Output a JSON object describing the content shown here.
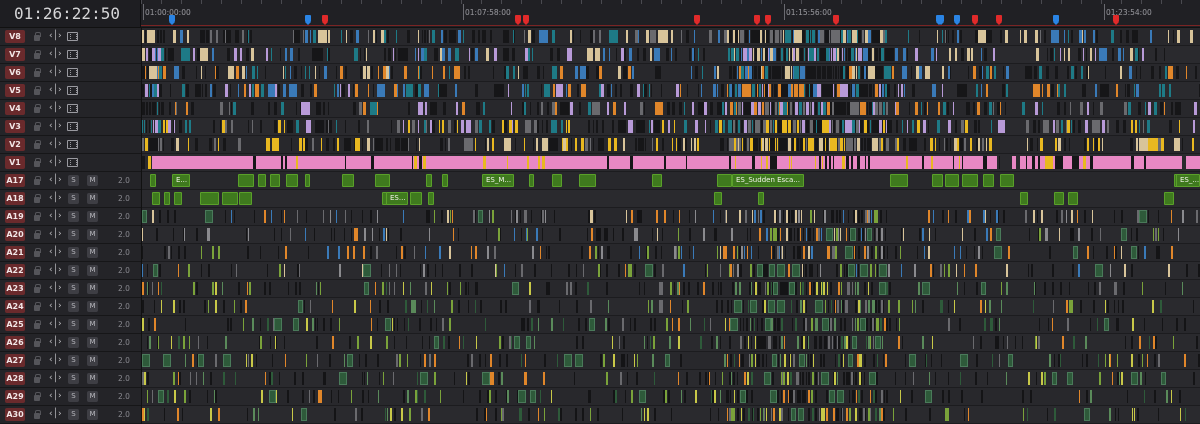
{
  "timecode": "01:26:22:50",
  "ruler": {
    "labels": [
      "01:00:00:00",
      "01:07:58:00",
      "01:15:56:00",
      "01:23:54:00"
    ]
  },
  "markers": [
    {
      "color": "blue"
    },
    {
      "color": "blue"
    },
    {
      "color": "red"
    },
    {
      "color": "red"
    },
    {
      "color": "red"
    },
    {
      "color": "red"
    },
    {
      "color": "red"
    },
    {
      "color": "red"
    },
    {
      "color": "red"
    },
    {
      "color": "blue"
    },
    {
      "color": "red"
    },
    {
      "color": "red"
    },
    {
      "color": "blue"
    },
    {
      "color": "red"
    },
    {
      "color": "blue"
    },
    {
      "color": "blue"
    },
    {
      "color": "red"
    },
    {
      "color": "red"
    }
  ],
  "tracks": {
    "video": [
      {
        "label": "V8"
      },
      {
        "label": "V7"
      },
      {
        "label": "V6"
      },
      {
        "label": "V5"
      },
      {
        "label": "V4"
      },
      {
        "label": "V3"
      },
      {
        "label": "V2"
      },
      {
        "label": "V1"
      }
    ],
    "audio": [
      {
        "label": "A17",
        "volume": "2.0",
        "solo": "S",
        "mute": "M"
      },
      {
        "label": "A18",
        "volume": "2.0",
        "solo": "S",
        "mute": "M"
      },
      {
        "label": "A19",
        "volume": "2.0",
        "solo": "S",
        "mute": "M"
      },
      {
        "label": "A20",
        "volume": "2.0",
        "solo": "S",
        "mute": "M"
      },
      {
        "label": "A21",
        "volume": "2.0",
        "solo": "S",
        "mute": "M"
      },
      {
        "label": "A22",
        "volume": "2.0",
        "solo": "S",
        "mute": "M"
      },
      {
        "label": "A23",
        "volume": "2.0",
        "solo": "S",
        "mute": "M"
      },
      {
        "label": "A24",
        "volume": "2.0",
        "solo": "S",
        "mute": "M"
      },
      {
        "label": "A25",
        "volume": "2.0",
        "solo": "S",
        "mute": "M"
      },
      {
        "label": "A26",
        "volume": "2.0",
        "solo": "S",
        "mute": "M"
      },
      {
        "label": "A27",
        "volume": "2.0",
        "solo": "S",
        "mute": "M"
      },
      {
        "label": "A28",
        "volume": "2.0",
        "solo": "S",
        "mute": "M"
      },
      {
        "label": "A29",
        "volume": "2.0",
        "solo": "S",
        "mute": "M"
      },
      {
        "label": "A30",
        "volume": "2.0",
        "solo": "S",
        "mute": "M"
      }
    ]
  },
  "named_clips": {
    "a17": [
      "E...",
      "ES_M...",
      "ES_Sudden Esca...",
      "ES_..."
    ],
    "a18": [
      "ES..."
    ]
  },
  "colors": {
    "pink": "#e888c4",
    "yellow": "#e8b820",
    "teal": "#1e7a86",
    "blue": "#3a7ab8",
    "lavender": "#b89ad8",
    "orange": "#e0862a",
    "beige": "#d8c49a",
    "gray": "#6a6a6e",
    "green": "#3f7a1e",
    "lightgreen": "#7aa23a",
    "audio_green": "#2e5a3a",
    "red_marker": "#e02a2a",
    "blue_marker": "#2a84e4"
  }
}
